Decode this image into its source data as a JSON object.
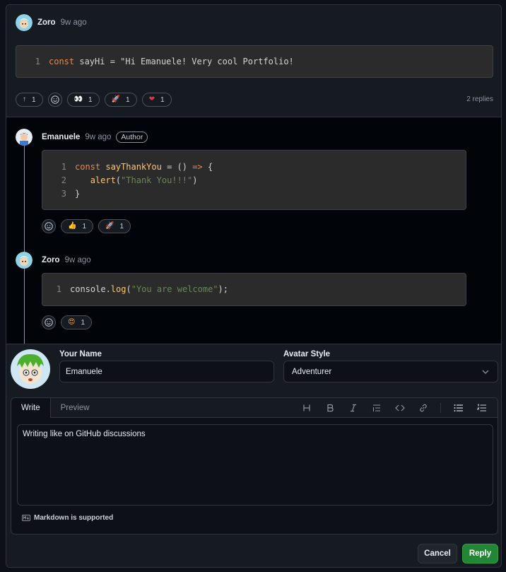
{
  "top_comment": {
    "author": "Zoro",
    "time": "9w ago",
    "code_lines": [
      {
        "n": "1",
        "tokens": [
          {
            "t": "const",
            "c": "kw"
          },
          {
            "t": " sayHi = \"Hi Emanuele! Very cool Portfolio!",
            "c": "plain"
          }
        ]
      }
    ],
    "reactions": [
      {
        "icon": "arrow-up-icon",
        "emoji": "↑",
        "count": "1"
      },
      {
        "icon": "eyes-icon",
        "emoji": "👀",
        "count": "1"
      },
      {
        "icon": "rocket-icon",
        "emoji": "🚀",
        "count": "1"
      },
      {
        "icon": "heart-icon",
        "emoji": "❤",
        "count": "1"
      }
    ],
    "replies_count": "2 replies"
  },
  "replies": [
    {
      "author": "Emanuele",
      "time": "9w ago",
      "badge": "Author",
      "code_lines": [
        {
          "n": "1",
          "tokens": [
            {
              "t": "const",
              "c": "kw"
            },
            {
              "t": " ",
              "c": "plain"
            },
            {
              "t": "sayThankYou",
              "c": "fn"
            },
            {
              "t": " = () ",
              "c": "plain"
            },
            {
              "t": "=>",
              "c": "kw"
            },
            {
              "t": " {",
              "c": "plain"
            }
          ]
        },
        {
          "n": "2",
          "tokens": [
            {
              "t": "   ",
              "c": "plain"
            },
            {
              "t": "alert",
              "c": "fn"
            },
            {
              "t": "(",
              "c": "plain"
            },
            {
              "t": "\"Thank You!!!\"",
              "c": "str"
            },
            {
              "t": ")",
              "c": "plain"
            }
          ]
        },
        {
          "n": "3",
          "tokens": [
            {
              "t": "}",
              "c": "plain"
            }
          ]
        }
      ],
      "reactions": [
        {
          "icon": "thumbs-up-icon",
          "emoji": "👍",
          "count": "1"
        },
        {
          "icon": "rocket-icon",
          "emoji": "🚀",
          "count": "1"
        }
      ]
    },
    {
      "author": "Zoro",
      "time": "9w ago",
      "badge": "",
      "code_lines": [
        {
          "n": "1",
          "tokens": [
            {
              "t": "console.",
              "c": "plain"
            },
            {
              "t": "log",
              "c": "fn"
            },
            {
              "t": "(",
              "c": "plain"
            },
            {
              "t": "\"You are welcome\"",
              "c": "str"
            },
            {
              "t": ");",
              "c": "plain"
            }
          ]
        }
      ],
      "reactions": [
        {
          "icon": "star-struck-icon",
          "emoji": "😍",
          "count": "1"
        }
      ]
    }
  ],
  "form": {
    "name_label": "Your Name",
    "name_value": "Emanuele",
    "avatar_label": "Avatar Style",
    "avatar_value": "Adventurer",
    "tab_write": "Write",
    "tab_preview": "Preview",
    "toolbar": [
      "heading-icon",
      "bold-icon",
      "italic-icon",
      "quote-icon",
      "code-icon",
      "link-icon",
      "unordered-list-icon",
      "ordered-list-icon"
    ],
    "body_text": "Writing like on GitHub discussions",
    "markdown_note": "Markdown is supported",
    "cancel_label": "Cancel",
    "reply_label": "Reply"
  },
  "colors": {
    "accent_green": "#238636",
    "code_bg": "#2b2b2b",
    "keyword": "#e5894f",
    "function": "#ffc66d",
    "string": "#6a8759"
  }
}
